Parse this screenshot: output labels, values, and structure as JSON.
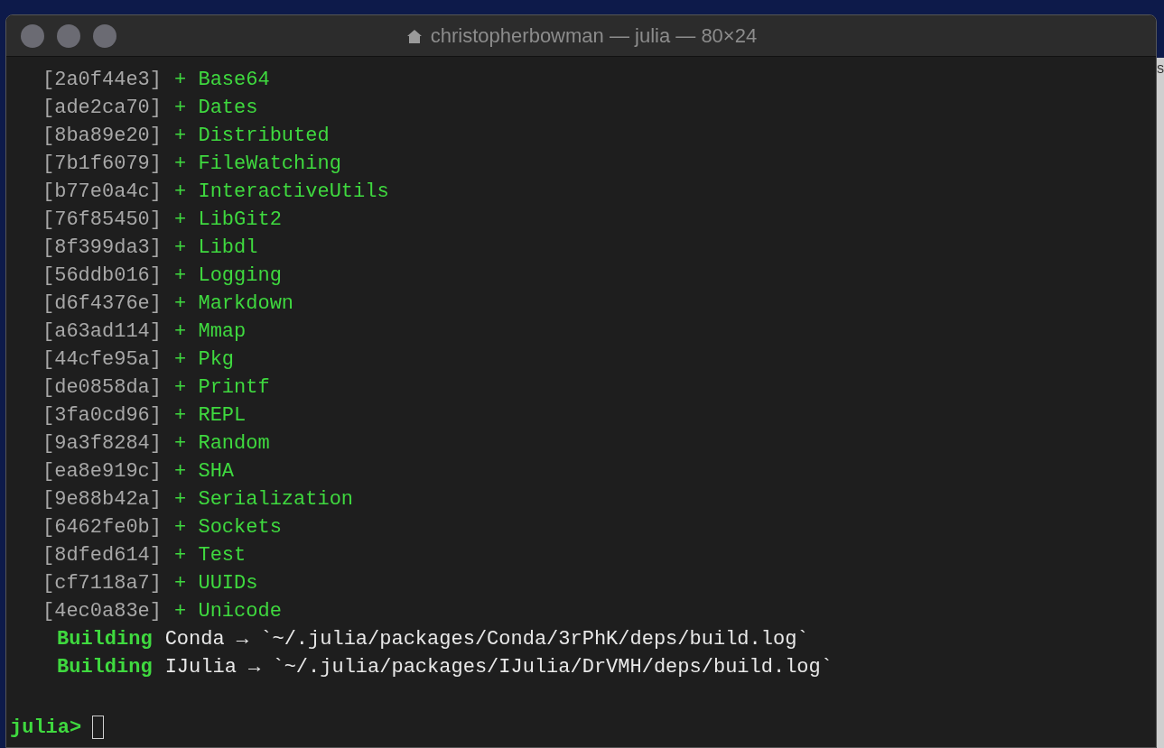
{
  "window": {
    "title": "christopherbowman — julia — 80×24"
  },
  "background_window": {
    "text": "S"
  },
  "lines": [
    {
      "kind": "package",
      "hash": "[2a0f44e3]",
      "plus": "+",
      "name": "Base64"
    },
    {
      "kind": "package",
      "hash": "[ade2ca70]",
      "plus": "+",
      "name": "Dates"
    },
    {
      "kind": "package",
      "hash": "[8ba89e20]",
      "plus": "+",
      "name": "Distributed"
    },
    {
      "kind": "package",
      "hash": "[7b1f6079]",
      "plus": "+",
      "name": "FileWatching"
    },
    {
      "kind": "package",
      "hash": "[b77e0a4c]",
      "plus": "+",
      "name": "InteractiveUtils"
    },
    {
      "kind": "package",
      "hash": "[76f85450]",
      "plus": "+",
      "name": "LibGit2"
    },
    {
      "kind": "package",
      "hash": "[8f399da3]",
      "plus": "+",
      "name": "Libdl"
    },
    {
      "kind": "package",
      "hash": "[56ddb016]",
      "plus": "+",
      "name": "Logging"
    },
    {
      "kind": "package",
      "hash": "[d6f4376e]",
      "plus": "+",
      "name": "Markdown"
    },
    {
      "kind": "package",
      "hash": "[a63ad114]",
      "plus": "+",
      "name": "Mmap"
    },
    {
      "kind": "package",
      "hash": "[44cfe95a]",
      "plus": "+",
      "name": "Pkg"
    },
    {
      "kind": "package",
      "hash": "[de0858da]",
      "plus": "+",
      "name": "Printf"
    },
    {
      "kind": "package",
      "hash": "[3fa0cd96]",
      "plus": "+",
      "name": "REPL"
    },
    {
      "kind": "package",
      "hash": "[9a3f8284]",
      "plus": "+",
      "name": "Random"
    },
    {
      "kind": "package",
      "hash": "[ea8e919c]",
      "plus": "+",
      "name": "SHA"
    },
    {
      "kind": "package",
      "hash": "[9e88b42a]",
      "plus": "+",
      "name": "Serialization"
    },
    {
      "kind": "package",
      "hash": "[6462fe0b]",
      "plus": "+",
      "name": "Sockets"
    },
    {
      "kind": "package",
      "hash": "[8dfed614]",
      "plus": "+",
      "name": "Test"
    },
    {
      "kind": "package",
      "hash": "[cf7118a7]",
      "plus": "+",
      "name": "UUIDs"
    },
    {
      "kind": "package",
      "hash": "[4ec0a83e]",
      "plus": "+",
      "name": "Unicode"
    },
    {
      "kind": "build",
      "label": "Building",
      "text": "Conda → `~/.julia/packages/Conda/3rPhK/deps/build.log`"
    },
    {
      "kind": "build",
      "label": "Building",
      "text": "IJulia → `~/.julia/packages/IJulia/DrVMH/deps/build.log`"
    },
    {
      "kind": "blank"
    },
    {
      "kind": "prompt",
      "label": "julia>"
    }
  ]
}
